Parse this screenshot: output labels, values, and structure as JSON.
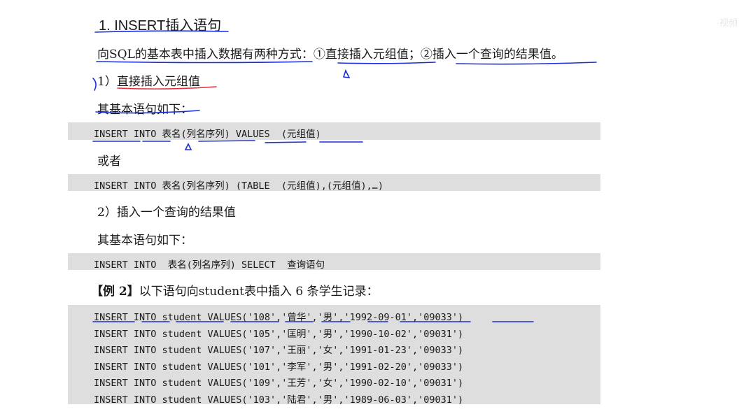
{
  "title": "1. INSERT插入语句",
  "intro": "向SQL的基本表中插入数据有两种方式：①直接插入元组值；②插入一个查询的结果值。",
  "section1": {
    "heading": "1）直接插入元组值",
    "syntax_intro": "其基本语句如下：",
    "syntax1": "INSERT INTO 表名(列名序列) VALUES  (元组值)",
    "or_text": "或者",
    "syntax2": "INSERT INTO 表名(列名序列) (TABLE  (元组值),(元组值),…)"
  },
  "section2": {
    "heading": "2）插入一个查询的结果值",
    "syntax_intro": "其基本语句如下：",
    "syntax": "INSERT INTO  表名(列名序列) SELECT  查询语句"
  },
  "example": {
    "label": "【例 2】",
    "text": "以下语句向student表中插入 6 条学生记录：",
    "lines": [
      "INSERT INTO student VALUES('108','曾华','男','1992-09-01','09033')",
      "INSERT INTO student VALUES('105','匡明','男','1990-10-02','09031')",
      "INSERT INTO student VALUES('107','王丽','女','1991-01-23','09033')",
      "INSERT INTO student VALUES('101','李军','男','1991-02-20','09033')",
      "INSERT INTO student VALUES('109','王芳','女','1990-02-10','09031')",
      "INSERT INTO student VALUES('103','陆君','男','1989-06-03','09031')"
    ]
  },
  "watermark": "·视频",
  "colors": {
    "code_bg": "#dedede",
    "ink_blue": "#1a2fd6",
    "ink_red": "#e0303a"
  }
}
